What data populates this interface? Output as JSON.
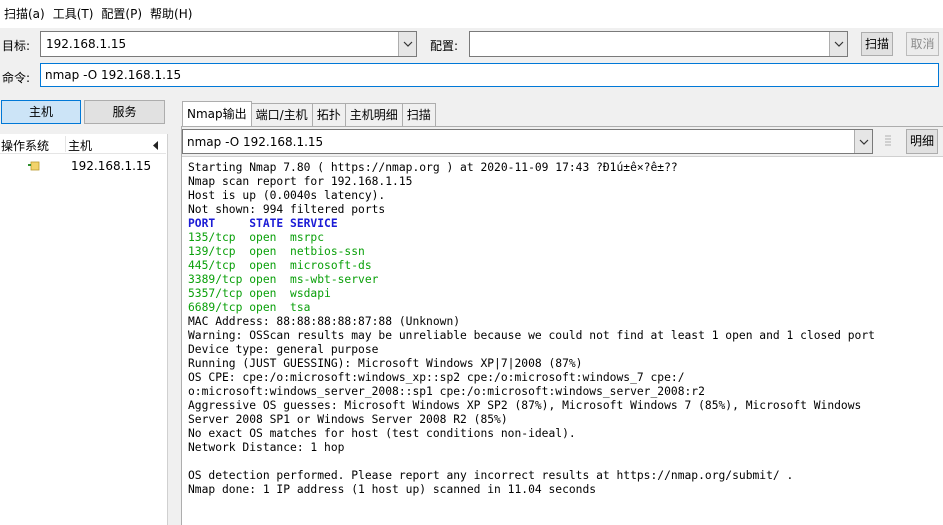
{
  "menu": [
    "扫描(a)",
    "工具(T)",
    "配置(P)",
    "帮助(H)"
  ],
  "toolbar": {
    "target_label": "目标:",
    "target_value": "192.168.1.15",
    "profile_label": "配置:",
    "profile_value": "",
    "scan_button": "扫描",
    "cancel_button": "取消",
    "command_label": "命令:",
    "command_value": "nmap -O 192.168.1.15"
  },
  "left": {
    "hosts_button": "主机",
    "services_button": "服务",
    "col_os": "操作系统",
    "col_host": "主机",
    "hosts": [
      {
        "ip": "192.168.1.15"
      }
    ]
  },
  "tabs": [
    "Nmap输出",
    "端口/主机",
    "拓扑",
    "主机明细",
    "扫描"
  ],
  "output_selector": {
    "value": "nmap -O 192.168.1.15",
    "details_button": "明细"
  },
  "output_lines": [
    "Starting Nmap 7.80 ( https://nmap.org ) at 2020-11-09 17:43 ?Ð1ú±ê×?ê±??",
    "Nmap scan report for 192.168.1.15",
    "Host is up (0.0040s latency).",
    "Not shown: 994 filtered ports",
    "PORT     STATE SERVICE",
    "135/tcp  open  msrpc",
    "139/tcp  open  netbios-ssn",
    "445/tcp  open  microsoft-ds",
    "3389/tcp open  ms-wbt-server",
    "5357/tcp open  wsdapi",
    "6689/tcp open  tsa",
    "MAC Address: 88:88:88:88:87:88 (Unknown)",
    "Warning: OSScan results may be unreliable because we could not find at least 1 open and 1 closed port",
    "Device type: general purpose",
    "Running (JUST GUESSING): Microsoft Windows XP|7|2008 (87%)",
    "OS CPE: cpe:/o:microsoft:windows_xp::sp2 cpe:/o:microsoft:windows_7 cpe:/",
    "o:microsoft:windows_server_2008::sp1 cpe:/o:microsoft:windows_server_2008:r2",
    "Aggressive OS guesses: Microsoft Windows XP SP2 (87%), Microsoft Windows 7 (85%), Microsoft Windows",
    "Server 2008 SP1 or Windows Server 2008 R2 (85%)",
    "No exact OS matches for host (test conditions non-ideal).",
    "Network Distance: 1 hop",
    "",
    "OS detection performed. Please report any incorrect results at https://nmap.org/submit/ .",
    "Nmap done: 1 IP address (1 host up) scanned in 11.04 seconds"
  ]
}
